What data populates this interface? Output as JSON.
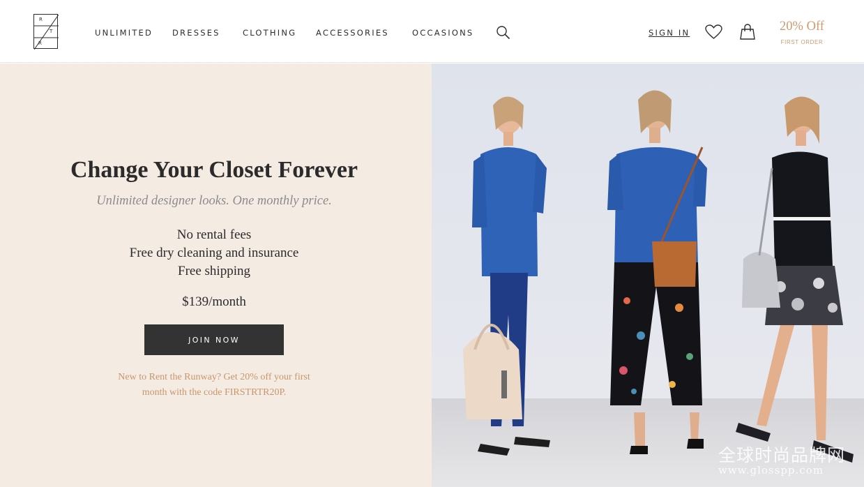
{
  "logo": {
    "letters": [
      "R",
      "T",
      "R"
    ]
  },
  "nav": {
    "items": [
      "UNLIMITED",
      "DRESSES",
      "CLOTHING",
      "ACCESSORIES",
      "OCCASIONS"
    ],
    "search_icon": "search-icon"
  },
  "account": {
    "sign_in": "SIGN IN",
    "heart_icon": "heart-icon",
    "bag_icon": "shopping-bag-icon"
  },
  "promo": {
    "main": "20% Off",
    "sub": "FIRST ORDER"
  },
  "hero": {
    "headline": "Change Your Closet Forever",
    "subhead": "Unlimited designer looks. One monthly price.",
    "features": [
      "No rental fees",
      "Free dry cleaning and insurance",
      "Free shipping"
    ],
    "price": "$139/month",
    "cta": "JOIN NOW",
    "note": "New to Rent the Runway? Get 20% off your first month with the code FIRSTRTR20P."
  },
  "watermark": {
    "text": "全球时尚品牌网",
    "url": "www.glosspp.com"
  },
  "colors": {
    "accent": "#cf9a6e",
    "panel_bg": "#f4ebe3",
    "button_bg": "#333333"
  }
}
